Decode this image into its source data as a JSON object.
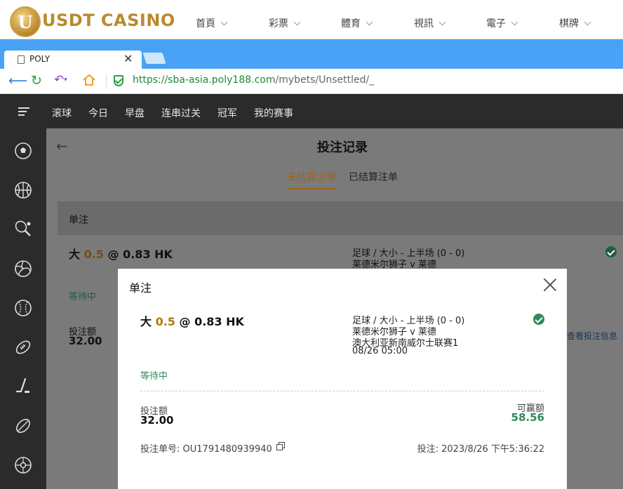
{
  "site": {
    "logo_letter": "U",
    "brand": "USDT CASINO",
    "nav": [
      "首頁",
      "彩票",
      "體育",
      "視訊",
      "電子",
      "棋牌"
    ]
  },
  "browser": {
    "tab_title": "POLY",
    "url_host": "https://sba-asia.poly188.com",
    "url_path": "/mybets/Unsettled/_"
  },
  "app": {
    "top_nav": [
      "滚球",
      "今日",
      "早盘",
      "连串过关",
      "冠军",
      "我的赛事"
    ],
    "sidebar_icons": [
      "soccer-icon",
      "basketball-icon",
      "tennis-icon",
      "volleyball-icon",
      "baseball-icon",
      "american-football-icon",
      "hockey-icon",
      "rugby-icon",
      "futsal-icon"
    ]
  },
  "page": {
    "title": "投注记录",
    "tabs": {
      "unsettled": "未结算注单",
      "settled": "已结算注单"
    },
    "section": "单注"
  },
  "background_bet": {
    "selection": "大",
    "handicap": "0.5",
    "at": "@",
    "odds": "0.83 HK",
    "market": "足球 / 大小 - 上半场 (0 - 0)",
    "match": "莱德米尔狮子 v 莱德",
    "status": "等待中",
    "stake_label": "投注额",
    "stake": "32.00",
    "view_link": "查看投注信息"
  },
  "modal": {
    "title": "单注",
    "selection": "大",
    "handicap": "0.5",
    "at": "@",
    "odds": "0.83 HK",
    "market": "足球 / 大小 - 上半场 (0 - 0)",
    "match": "莱德米尔狮子 v 莱德",
    "league": "澳大利亚新南威尔士联赛1",
    "kickoff": "08/26 05:00",
    "status": "等待中",
    "stake_label": "投注额",
    "stake": "32.00",
    "win_label": "可赢额",
    "win": "58.56",
    "ticket_label": "投注单号:",
    "ticket_id": "OU1791480939940",
    "placed_label": "投注:",
    "placed_time": "2023/8/26 下午5:36:22"
  }
}
